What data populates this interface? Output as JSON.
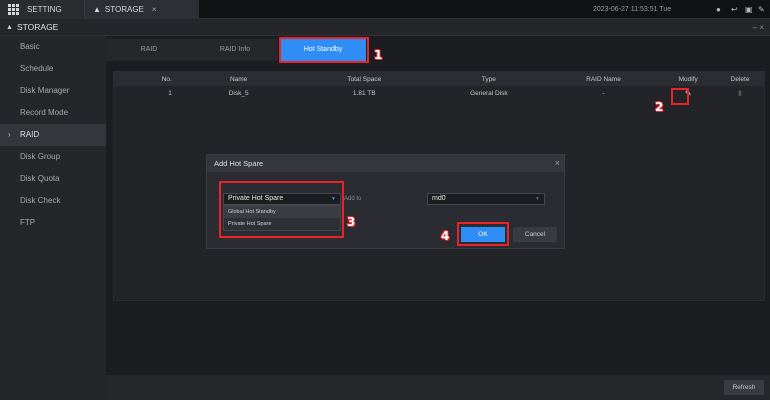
{
  "topbar": {
    "setting_tab": "SETTING",
    "storage_tab": "STORAGE",
    "close": "×",
    "datetime": "2023-06-27 11:53:51 Tue",
    "icons": [
      "user-icon",
      "logout-icon",
      "fullscreen-icon",
      "edit-icon"
    ]
  },
  "subbar": {
    "title": "STORAGE",
    "controls": "– ×"
  },
  "sidebar": {
    "items": [
      {
        "label": "Basic"
      },
      {
        "label": "Schedule"
      },
      {
        "label": "Disk Manager"
      },
      {
        "label": "Record Mode"
      },
      {
        "label": "RAID",
        "active": true
      },
      {
        "label": "Disk Group"
      },
      {
        "label": "Disk Quota"
      },
      {
        "label": "Disk Check"
      },
      {
        "label": "FTP"
      }
    ]
  },
  "tabs": [
    "RAID",
    "RAID Info",
    "Hot Standby"
  ],
  "table": {
    "headers": [
      "No.",
      "Name",
      "Total Space",
      "Type",
      "RAID Name",
      "Modify",
      "Delete"
    ],
    "rows": [
      {
        "no": "1",
        "name": "Disk_5",
        "total": "1.81 TB",
        "type": "General Disk",
        "raid": "-"
      }
    ]
  },
  "dialog": {
    "title": "Add Hot Spare",
    "close": "×",
    "spare_type": "Private Hot Spare",
    "options": [
      "Global Hot Standby",
      "Private Hot Spare"
    ],
    "add_to_label": "Add to",
    "add_to_value": "md0",
    "ok": "OK",
    "cancel": "Cancel"
  },
  "refresh": "Refresh",
  "markers": [
    "1",
    "2",
    "3",
    "4"
  ],
  "colors": {
    "accent": "#2f8df6",
    "marker": "#e8242a"
  }
}
